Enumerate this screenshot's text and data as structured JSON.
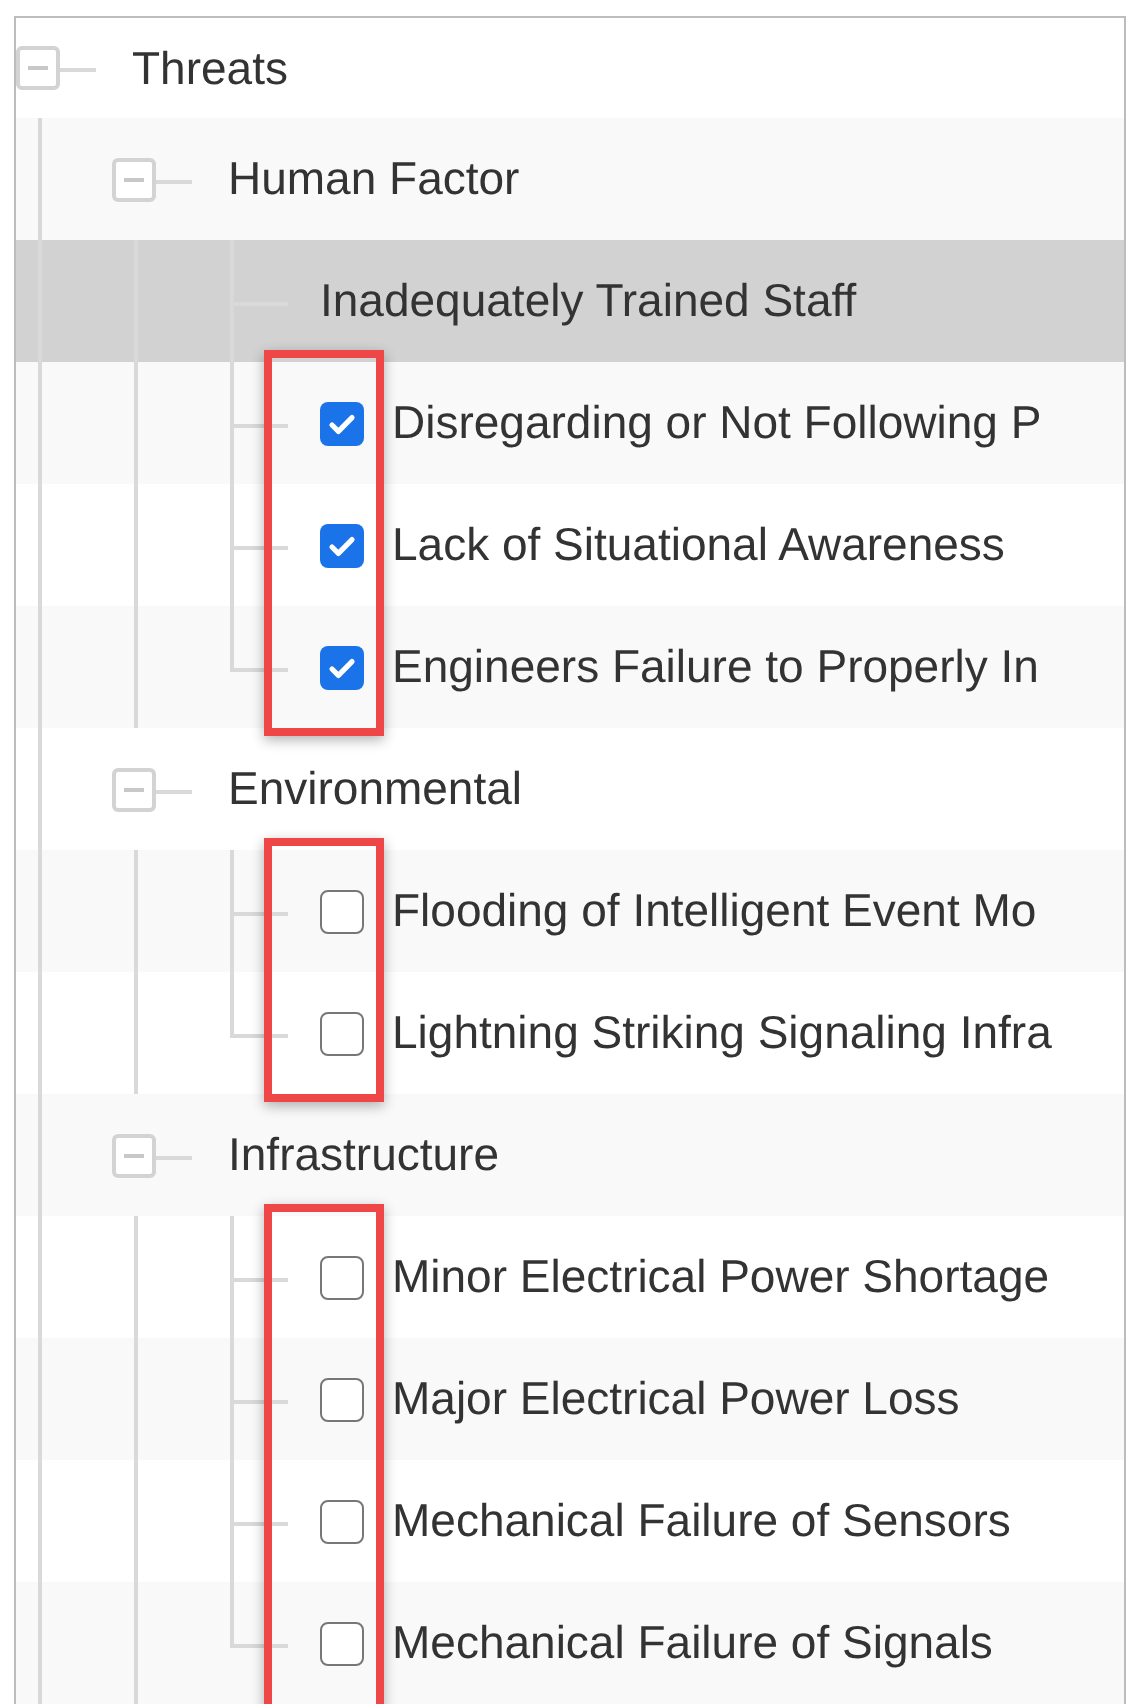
{
  "tree": [
    {
      "label": "Threats",
      "expanded": true,
      "children": [
        {
          "label": "Human Factor",
          "expanded": true,
          "highlighted": true,
          "children": [
            {
              "kind": "label",
              "label": "Inadequately Trained Staff",
              "selected": true
            },
            {
              "kind": "checkbox",
              "label": "Disregarding or Not Following P",
              "checked": true,
              "selected": false
            },
            {
              "kind": "checkbox",
              "label": "Lack of Situational Awareness",
              "checked": true,
              "selected": false
            },
            {
              "kind": "checkbox",
              "label": "Engineers Failure to Properly In",
              "checked": true,
              "selected": false
            }
          ]
        },
        {
          "label": "Environmental",
          "expanded": true,
          "highlighted": true,
          "children": [
            {
              "kind": "checkbox",
              "label": "Flooding of Intelligent Event Mo",
              "checked": false,
              "selected": false
            },
            {
              "kind": "checkbox",
              "label": "Lightning Striking Signaling Infra",
              "checked": false,
              "selected": false
            }
          ]
        },
        {
          "label": "Infrastructure",
          "expanded": true,
          "highlighted": true,
          "children": [
            {
              "kind": "checkbox",
              "label": "Minor Electrical Power Shortage",
              "checked": false,
              "selected": false
            },
            {
              "kind": "checkbox",
              "label": "Major Electrical Power Loss",
              "checked": false,
              "selected": false
            },
            {
              "kind": "checkbox",
              "label": "Mechanical Failure of Sensors",
              "checked": false,
              "selected": false
            },
            {
              "kind": "checkbox",
              "label": "Mechanical Failure of Signals",
              "checked": false,
              "selected": false
            }
          ]
        }
      ]
    }
  ]
}
